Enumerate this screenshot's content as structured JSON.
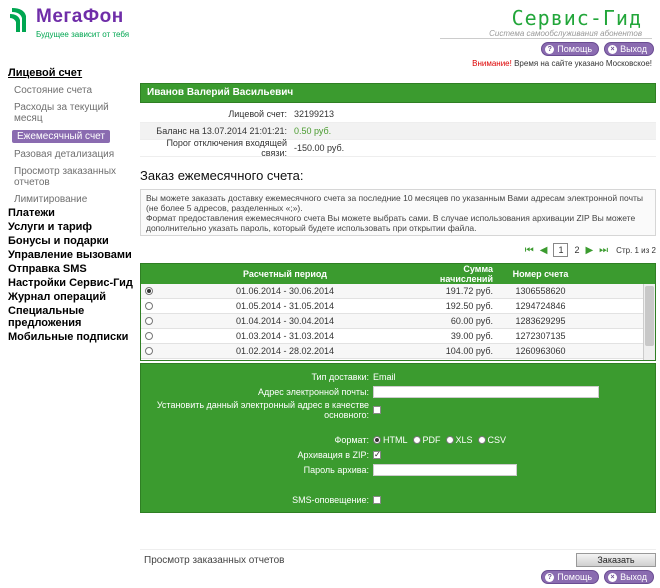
{
  "header": {
    "logo_text": "МегаФон",
    "logo_tagline": "Будущее зависит от тебя",
    "brand_title": "Сервис-Гид",
    "brand_subtitle": "Система самообслуживания абонентов",
    "help_label": "Помощь",
    "exit_label": "Выход",
    "notice_warn": "Внимание!",
    "notice_text": "Время на сайте указано Московское!"
  },
  "sidebar": {
    "account": "Лицевой счет",
    "account_items": [
      "Состояние счета",
      "Расходы за текущий месяц",
      "Ежемесячный счет",
      "Разовая детализация",
      "Просмотр заказанных отчетов",
      "Лимитирование"
    ],
    "sections": [
      "Платежи",
      "Услуги и тариф",
      "Бонусы и подарки",
      "Управление вызовами",
      "Отправка SMS",
      "Настройки Сервис-Гид",
      "Журнал операций",
      "Специальные предложения",
      "Мобильные подписки"
    ]
  },
  "account_info": {
    "name": "Иванов Валерий Васильевич",
    "rows": [
      {
        "label": "Лицевой счет:",
        "value": "32199213"
      },
      {
        "label": "Баланс на 13.07.2014 21:01:21:",
        "value": "0.50 руб."
      },
      {
        "label": "Порог отключения входящей связи:",
        "value": "-150.00 руб."
      }
    ]
  },
  "order": {
    "title": "Заказ ежемесячного счета:",
    "description_1": "Вы можете заказать доставку ежемесячного счета за последние 10 месяцев по указанным Вами адресам электронной почты (не более 5 адресов, разделенных «;»).",
    "description_2": "Формат предоставления ежемесячного счета Вы можете выбрать сами. В случае использования архивации ZIP Вы можете дополнительно указать пароль, который будете использовать при открытии файла."
  },
  "pager": {
    "current": "1",
    "next": "2",
    "page_info": "Стр. 1 из 2"
  },
  "table": {
    "headers": [
      "Расчетный период",
      "Сумма начислений",
      "Номер счета"
    ],
    "rows": [
      {
        "period": "01.06.2014 - 30.06.2014",
        "sum": "191.72 руб.",
        "number": "1306558620",
        "selected": true
      },
      {
        "period": "01.05.2014 - 31.05.2014",
        "sum": "192.50 руб.",
        "number": "1294724846",
        "selected": false
      },
      {
        "period": "01.04.2014 - 30.04.2014",
        "sum": "60.00 руб.",
        "number": "1283629295",
        "selected": false
      },
      {
        "period": "01.03.2014 - 31.03.2014",
        "sum": "39.00 руб.",
        "number": "1272307135",
        "selected": false
      },
      {
        "period": "01.02.2014 - 28.02.2014",
        "sum": "104.00 руб.",
        "number": "1260963060",
        "selected": false
      }
    ]
  },
  "form": {
    "delivery_label": "Тип доставки:",
    "delivery_value": "Email",
    "email_label": "Адрес электронной почты:",
    "email_value": "",
    "set_default_label": "Установить данный электронный адрес в качестве основного:",
    "format_label": "Формат:",
    "formats": [
      "HTML",
      "PDF",
      "XLS",
      "CSV"
    ],
    "zip_label": "Архивация в ZIP:",
    "password_label": "Пароль архива:",
    "password_value": "",
    "sms_label": "SMS-оповещение:"
  },
  "footer": {
    "reports_link": "Просмотр заказанных отчетов",
    "order_button": "Заказать"
  },
  "colors": {
    "brand_green": "#3b9b2f",
    "brand_purple": "#6f2da8",
    "warning": "#dd0000"
  }
}
